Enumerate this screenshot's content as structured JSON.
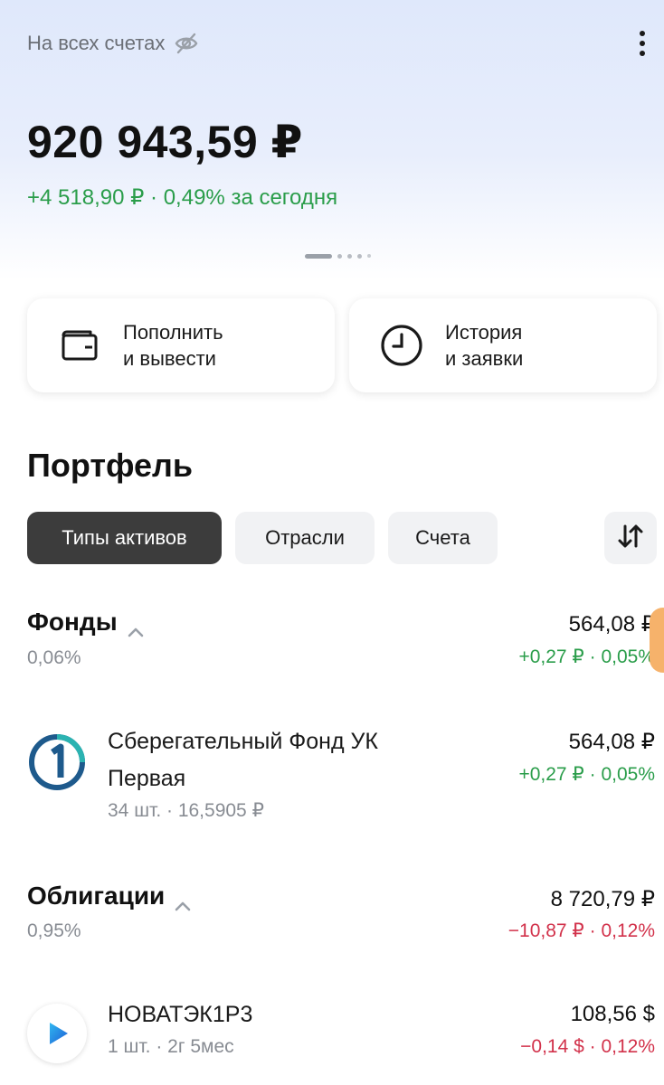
{
  "header": {
    "accounts_label": "На всех счетах",
    "visibility_icon": "eye-off-icon",
    "menu_icon": "more-vertical-icon"
  },
  "summary": {
    "balance": "920 943,59 ₽",
    "daily_change_value": "+4 518,90 ₽ · 0,49%",
    "daily_change_suffix": "за сегодня",
    "pager_pages": 5,
    "pager_active": 1
  },
  "actions": [
    {
      "line1": "Пополнить",
      "line2": "и вывести",
      "icon": "wallet-icon"
    },
    {
      "line1": "История",
      "line2": "и заявки",
      "icon": "clock-icon"
    }
  ],
  "portfolio": {
    "title": "Портфель",
    "tabs": [
      {
        "label": "Типы активов",
        "active": true
      },
      {
        "label": "Отрасли",
        "active": false
      },
      {
        "label": "Счета",
        "active": false
      }
    ],
    "sort_icon": "sort-arrows-icon",
    "groups": [
      {
        "name": "Фонды",
        "share": "0,06%",
        "amount": "564,08 ₽",
        "change": "+0,27 ₽ · 0,05%",
        "change_dir": "positive",
        "assets": [
          {
            "name_line1": "Сберегательный Фонд УК",
            "name_line2": "Первая",
            "meta": "34 шт. · 16,5905 ₽",
            "amount": "564,08 ₽",
            "change": "+0,27 ₽ · 0,05%",
            "logo": "pervaya-logo-icon"
          }
        ]
      },
      {
        "name": "Облигации",
        "share": "0,95%",
        "amount": "8 720,79 ₽",
        "change": "−10,87 ₽ · 0,12%",
        "change_dir": "negative",
        "assets": [
          {
            "name_line1": "НОВАТЭК1Р3",
            "meta": "1 шт. · 2г 5мес",
            "amount": "108,56 $",
            "change": "−0,14 $ · 0,12%",
            "logo": "novatek-logo-icon"
          }
        ]
      }
    ]
  },
  "colors": {
    "positive": "#2a9d4a",
    "negative": "#d2324b",
    "active_chip": "#3c3c3c",
    "inactive_chip": "#f1f2f4",
    "header_gradient": "#dfe8fb"
  }
}
